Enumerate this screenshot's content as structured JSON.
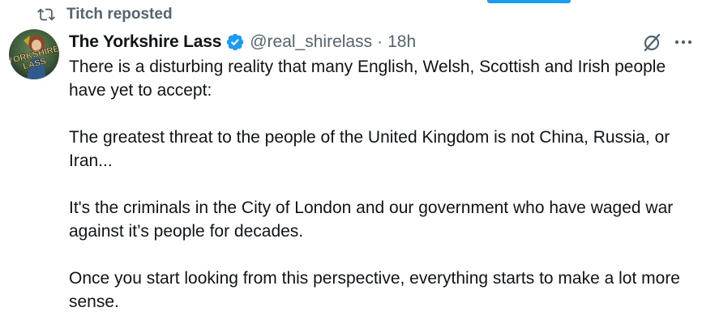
{
  "repost": {
    "label": "Titch reposted",
    "icon": "repost-icon"
  },
  "author": {
    "display_name": "The Yorkshire Lass",
    "handle": "@real_shirelass",
    "separator": "·",
    "time": "18h",
    "verified_color": "#1d9bf0",
    "avatar_text_line1": "YORKSHIRE",
    "avatar_text_line2": "LASS"
  },
  "actions": {
    "grok_icon": "grok-icon",
    "more_icon": "more-icon"
  },
  "tweet": {
    "paragraphs": [
      "There is a disturbing reality that many English, Welsh, Scottish and Irish people have yet to accept:",
      "The greatest threat to the people of the United Kingdom is not China, Russia, or Iran...",
      "It's the criminals in the City of London and our government who have waged war against it’s people for decades.",
      "Once you start looking from this perspective, everything starts to make a lot more sense."
    ]
  },
  "colors": {
    "text_primary": "#0f1419",
    "text_secondary": "#536471",
    "accent": "#1d9bf0"
  }
}
